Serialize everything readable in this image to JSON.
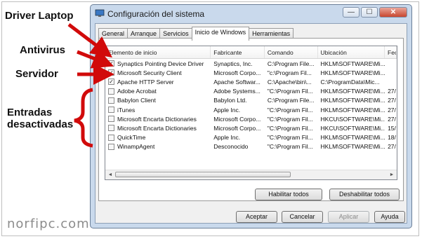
{
  "annotations": {
    "driver": "Driver Laptop",
    "antivirus": "Antivirus",
    "servidor": "Servidor",
    "entradas_line1": "Entradas",
    "entradas_line2": "desactivadas"
  },
  "watermark": "norfipc.com",
  "window": {
    "title": "Configuración del sistema",
    "minimize": "—",
    "maximize": "☐",
    "close": "✕"
  },
  "tabs": [
    {
      "label": "General"
    },
    {
      "label": "Arranque"
    },
    {
      "label": "Servicios"
    },
    {
      "label": "Inicio de Windows"
    },
    {
      "label": "Herramientas"
    }
  ],
  "table": {
    "headers": [
      "Elemento de inicio",
      "Fabricante",
      "Comando",
      "Ubicación",
      "Fec"
    ],
    "rows": [
      {
        "checked": true,
        "name": "Synaptics Pointing Device Driver",
        "maker": "Synaptics, Inc.",
        "cmd": "C:\\Program File...",
        "loc": "HKLM\\SOFTWARE\\Mi...",
        "date": ""
      },
      {
        "checked": true,
        "name": "Microsoft Security Client",
        "maker": "Microsoft Corpo...",
        "cmd": "\"c:\\Program Fil...",
        "loc": "HKLM\\SOFTWARE\\Mi...",
        "date": ""
      },
      {
        "checked": true,
        "name": "Apache HTTP Server",
        "maker": "Apache Softwar...",
        "cmd": "C:\\Apache\\bin\\...",
        "loc": "C:\\ProgramData\\Mic...",
        "date": ""
      },
      {
        "checked": false,
        "name": "Adobe Acrobat",
        "maker": "Adobe Systems...",
        "cmd": "\"C:\\Program Fil...",
        "loc": "HKLM\\SOFTWARE\\Mi...",
        "date": "27/"
      },
      {
        "checked": false,
        "name": "Babylon Client",
        "maker": "Babylon Ltd.",
        "cmd": "C:\\Program File...",
        "loc": "HKLM\\SOFTWARE\\Mi...",
        "date": "27/"
      },
      {
        "checked": false,
        "name": "iTunes",
        "maker": "Apple Inc.",
        "cmd": "\"C:\\Program Fil...",
        "loc": "HKLM\\SOFTWARE\\Mi...",
        "date": "27/"
      },
      {
        "checked": false,
        "name": "Microsoft Encarta Dictionaries",
        "maker": "Microsoft Corpo...",
        "cmd": "\"C:\\Program Fil...",
        "loc": "HKCU\\SOFTWARE\\Mi...",
        "date": "27/"
      },
      {
        "checked": false,
        "name": "Microsoft Encarta Dictionaries",
        "maker": "Microsoft Corpo...",
        "cmd": "\"C:\\Program Fil...",
        "loc": "HKCU\\SOFTWARE\\Mi...",
        "date": "15/"
      },
      {
        "checked": false,
        "name": "QuickTime",
        "maker": "Apple Inc.",
        "cmd": "\"C:\\Program Fil...",
        "loc": "HKLM\\SOFTWARE\\Mi...",
        "date": "18/"
      },
      {
        "checked": false,
        "name": "WinampAgent",
        "maker": "Desconocido",
        "cmd": "\"C:\\Program Fil...",
        "loc": "HKLM\\SOFTWARE\\Mi...",
        "date": "27/"
      }
    ]
  },
  "buttons": {
    "habilitar": "Habilitar todos",
    "deshabilitar": "Deshabilitar todos",
    "aceptar": "Aceptar",
    "cancelar": "Cancelar",
    "aplicar": "Aplicar",
    "ayuda": "Ayuda"
  },
  "scroll": {
    "left": "◄",
    "right": "►"
  },
  "colors": {
    "arrow": "#d10a0a"
  }
}
